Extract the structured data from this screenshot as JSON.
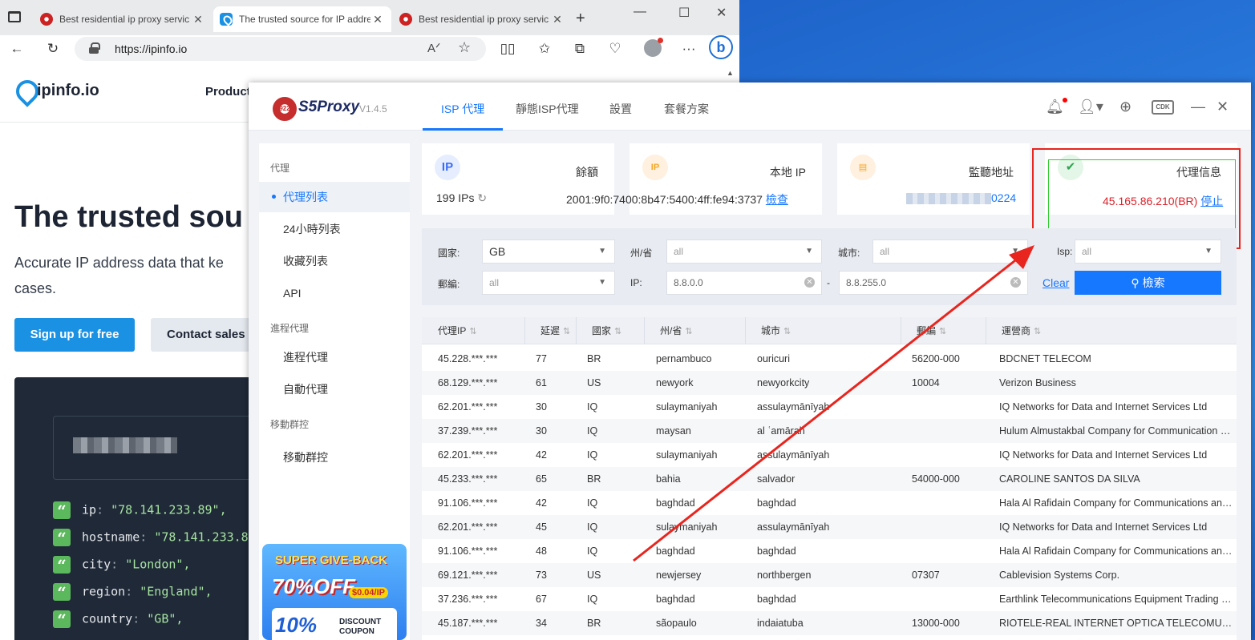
{
  "browser": {
    "tabs": [
      {
        "title": "Best residential ip proxy servic",
        "close": "✕"
      },
      {
        "title": "The trusted source for IP addre",
        "close": "✕"
      },
      {
        "title": "Best residential ip proxy servic",
        "close": "✕"
      }
    ],
    "url": "https://ipinfo.io",
    "new_tab": "+"
  },
  "site": {
    "logo": "ipinfo.io",
    "nav_product": "Product",
    "hero": "The trusted sou",
    "sub": "Accurate IP address data that ke cases.",
    "signup": "Sign up for free",
    "contact": "Contact sales",
    "json_lines": [
      {
        "key": "ip",
        "value": "\"78.141.233.89\","
      },
      {
        "key": "hostname",
        "value": "\"78.141.233.89"
      },
      {
        "key": "city",
        "value": "\"London\","
      },
      {
        "key": "region",
        "value": "\"England\","
      },
      {
        "key": "country",
        "value": "\"GB\","
      }
    ]
  },
  "app": {
    "logo_badge": "922",
    "name": "S5Proxy",
    "version": "V1.4.5",
    "tabs": [
      "ISP 代理",
      "靜態ISP代理",
      "設置",
      "套餐方案"
    ],
    "cdk": "CDK",
    "sidebar": {
      "sec_proxy": "代理",
      "items_proxy": [
        "代理列表",
        "24小時列表",
        "收藏列表",
        "API"
      ],
      "sec_process": "進程代理",
      "items_process": [
        "進程代理",
        "自動代理"
      ],
      "sec_mobile": "移動群控",
      "items_mobile": [
        "移動群控"
      ]
    },
    "promo": {
      "line1": "SUPER GIVE-BACK",
      "line2": "70%OFF",
      "price": "$0.04/IP",
      "pct": "10%",
      "disc": "DISCOUNT COUPON"
    },
    "cards": {
      "balance_title": "餘額",
      "balance_value": "199 IPs",
      "local_title": "本地 IP",
      "local_value": "2001:9f0:7400:8b47:5400:4ff:fe94:3737",
      "local_link": "檢查",
      "listen_title": "監聽地址",
      "listen_value": "0224",
      "proxy_title": "代理信息",
      "proxy_value": "45.165.86.210(BR)",
      "proxy_link": "停止"
    },
    "filter": {
      "country_label": "國家:",
      "country_value": "GB",
      "state_label": "州/省",
      "state_placeholder": "all",
      "city_label": "城市:",
      "city_placeholder": "all",
      "isp_label": "Isp:",
      "isp_placeholder": "all",
      "zip_label": "郵編:",
      "zip_placeholder": "all",
      "ip_label": "IP:",
      "ip_from": "8.8.0.0",
      "ip_dash": "-",
      "ip_to": "8.8.255.0",
      "clear": "Clear",
      "search": "檢索"
    },
    "table": {
      "headers": [
        "代理IP",
        "延遲",
        "國家",
        "州/省",
        "城市",
        "郵編",
        "運營商"
      ],
      "rows": [
        [
          "45.228.***.***",
          "77",
          "BR",
          "pernambuco",
          "ouricuri",
          "56200-000",
          "BDCNET TELECOM"
        ],
        [
          "68.129.***.***",
          "61",
          "US",
          "newyork",
          "newyorkcity",
          "10004",
          "Verizon Business"
        ],
        [
          "62.201.***.***",
          "30",
          "IQ",
          "sulaymaniyah",
          "assulaymānīyah",
          "",
          "IQ Networks for Data and Internet Services Ltd"
        ],
        [
          "37.239.***.***",
          "30",
          "IQ",
          "maysan",
          "al ʿamārah",
          "",
          "Hulum Almustakbal Company for Communication Engineering"
        ],
        [
          "62.201.***.***",
          "42",
          "IQ",
          "sulaymaniyah",
          "assulaymānīyah",
          "",
          "IQ Networks for Data and Internet Services Ltd"
        ],
        [
          "45.233.***.***",
          "65",
          "BR",
          "bahia",
          "salvador",
          "54000-000",
          "CAROLINE SANTOS DA SILVA"
        ],
        [
          "91.106.***.***",
          "42",
          "IQ",
          "baghdad",
          "baghdad",
          "",
          "Hala Al Rafidain Company for Communications and Internet"
        ],
        [
          "62.201.***.***",
          "45",
          "IQ",
          "sulaymaniyah",
          "assulaymānīyah",
          "",
          "IQ Networks for Data and Internet Services Ltd"
        ],
        [
          "91.106.***.***",
          "48",
          "IQ",
          "baghdad",
          "baghdad",
          "",
          "Hala Al Rafidain Company for Communications and Internet"
        ],
        [
          "69.121.***.***",
          "73",
          "US",
          "newjersey",
          "northbergen",
          "07307",
          "Cablevision Systems Corp."
        ],
        [
          "37.236.***.***",
          "67",
          "IQ",
          "baghdad",
          "baghdad",
          "",
          "Earthlink Telecommunications Equipment Trading & Services"
        ],
        [
          "45.187.***.***",
          "34",
          "BR",
          "sãopaulo",
          "indaiatuba",
          "13000-000",
          "RIOTELE-REAL INTERNET OPTICA TELECOMUNICACOES"
        ]
      ]
    }
  },
  "colors": {
    "accent": "#1677ff",
    "annotation_red": "#e8251e",
    "proxy_value": "#d9232a"
  }
}
